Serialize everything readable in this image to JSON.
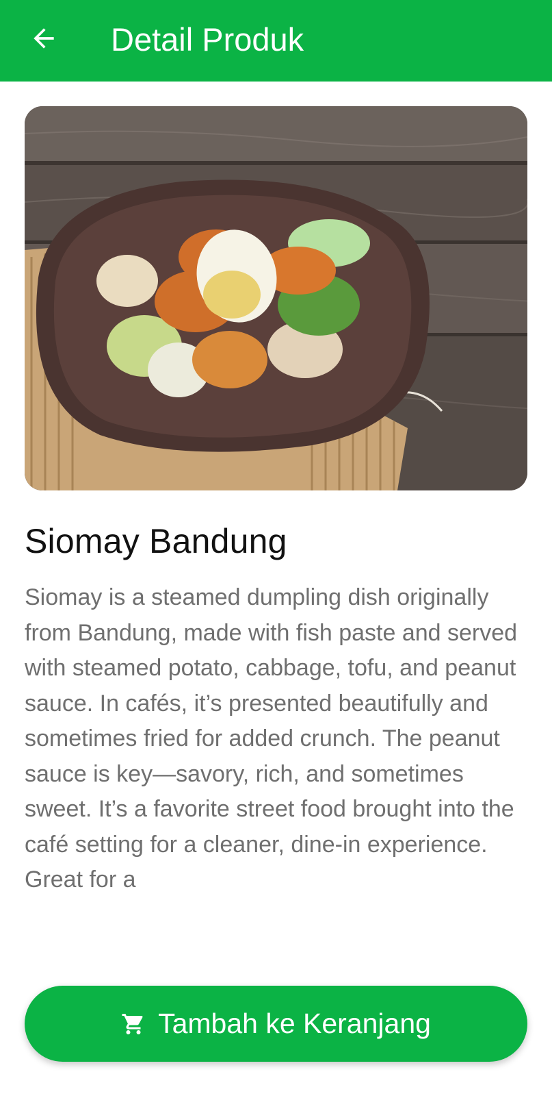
{
  "appbar": {
    "title": "Detail Produk",
    "back_icon": "arrow-left-icon",
    "color": "#0bb345"
  },
  "product": {
    "image_alt": "Siomay Bandung dish on a brown plate",
    "name": "Siomay Bandung",
    "description": "Siomay is a steamed dumpling dish originally from Bandung, made with fish paste and served with steamed potato, cabbage, tofu, and peanut sauce. In cafés, it’s presented beautifully and sometimes fried for added crunch. The peanut sauce is key—savory, rich, and sometimes sweet. It’s a favorite street food brought into the café setting for a cleaner, dine-in experience. Great for a"
  },
  "cart_button": {
    "label": "Tambah ke Keranjang",
    "icon": "cart-icon",
    "color": "#0bb345"
  }
}
